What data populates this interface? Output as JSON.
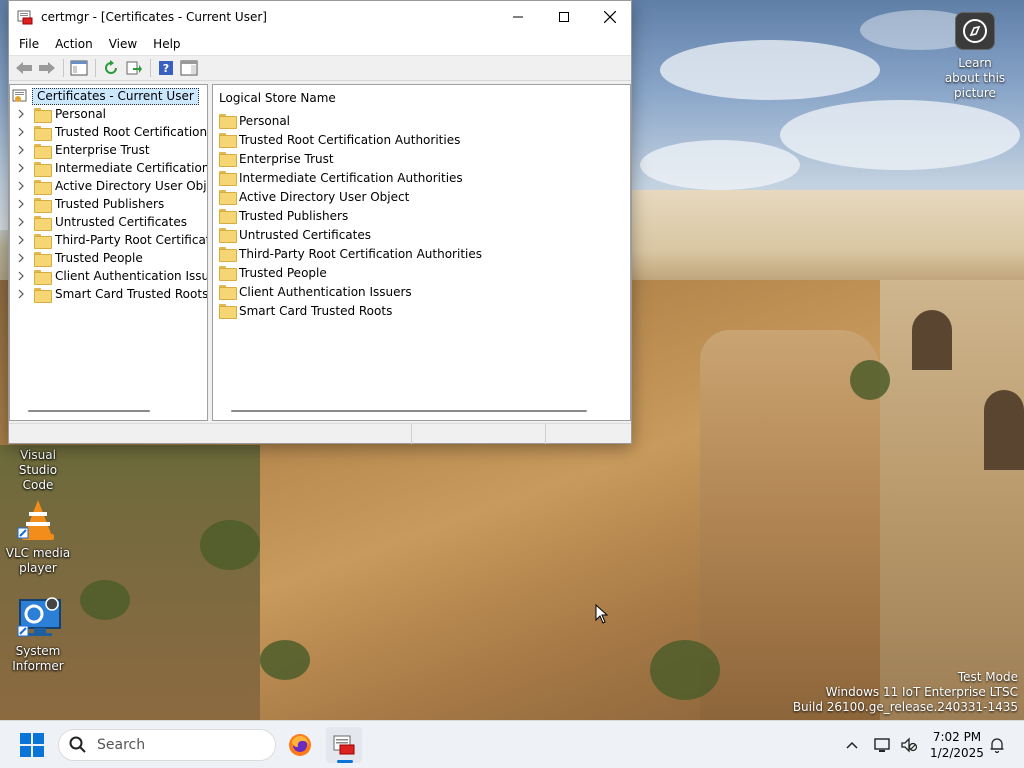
{
  "window": {
    "title": "certmgr - [Certificates - Current User]",
    "menus": [
      "File",
      "Action",
      "View",
      "Help"
    ]
  },
  "tree": {
    "root": "Certificates - Current User",
    "items": [
      "Personal",
      "Trusted Root Certification Au",
      "Enterprise Trust",
      "Intermediate Certification Au",
      "Active Directory User Object",
      "Trusted Publishers",
      "Untrusted Certificates",
      "Third-Party Root Certificatior",
      "Trusted People",
      "Client Authentication Issuers",
      "Smart Card Trusted Roots"
    ]
  },
  "list": {
    "header": "Logical Store Name",
    "items": [
      "Personal",
      "Trusted Root Certification Authorities",
      "Enterprise Trust",
      "Intermediate Certification Authorities",
      "Active Directory User Object",
      "Trusted Publishers",
      "Untrusted Certificates",
      "Third-Party Root Certification Authorities",
      "Trusted People",
      "Client Authentication Issuers",
      "Smart Card Trusted Roots"
    ]
  },
  "desktop": {
    "learn": "Learn about this picture",
    "icons": [
      {
        "label": "Visual Studio Code"
      },
      {
        "label": "VLC media player"
      },
      {
        "label": "System Informer"
      }
    ],
    "watermark": {
      "line1": "Test Mode",
      "line2": "Windows 11 IoT Enterprise LTSC",
      "line3": "Build 26100.ge_release.240331-1435"
    }
  },
  "taskbar": {
    "search_placeholder": "Search",
    "time": "7:02 PM",
    "date": "1/2/2025"
  }
}
